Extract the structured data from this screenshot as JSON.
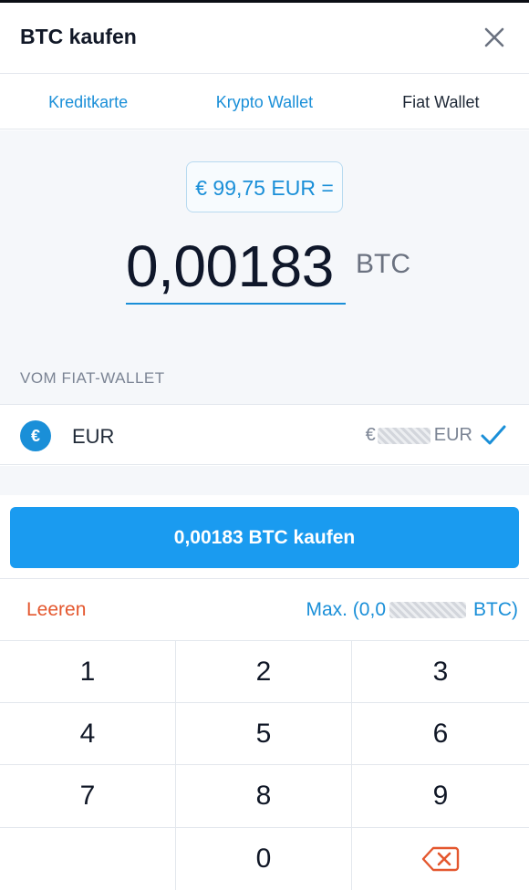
{
  "header": {
    "title": "BTC kaufen"
  },
  "tabs": [
    {
      "label": "Kreditkarte",
      "active": false
    },
    {
      "label": "Krypto Wallet",
      "active": false
    },
    {
      "label": "Fiat Wallet",
      "active": true
    }
  ],
  "amount": {
    "fiat_label": "€ 99,75 EUR =",
    "crypto_value": "0,00183",
    "crypto_unit": "BTC"
  },
  "source": {
    "section_label": "VOM FIAT-WALLET",
    "currency_symbol": "€",
    "currency": "EUR",
    "balance_prefix": "€",
    "balance_suffix": "EUR",
    "selected": true
  },
  "actions": {
    "buy_label": "0,00183 BTC kaufen",
    "clear_label": "Leeren",
    "max_prefix": "Max. (0,0",
    "max_suffix": "BTC)"
  },
  "keypad": {
    "keys": [
      "1",
      "2",
      "3",
      "4",
      "5",
      "6",
      "7",
      "8",
      "9",
      "",
      "0",
      "backspace"
    ]
  },
  "colors": {
    "accent": "#1a8fd8",
    "button": "#1a9bf0",
    "clear": "#e4572e",
    "background_muted": "#f5f7fa"
  },
  "icons": [
    "close-icon",
    "euro-icon",
    "checkmark-icon",
    "backspace-icon"
  ]
}
